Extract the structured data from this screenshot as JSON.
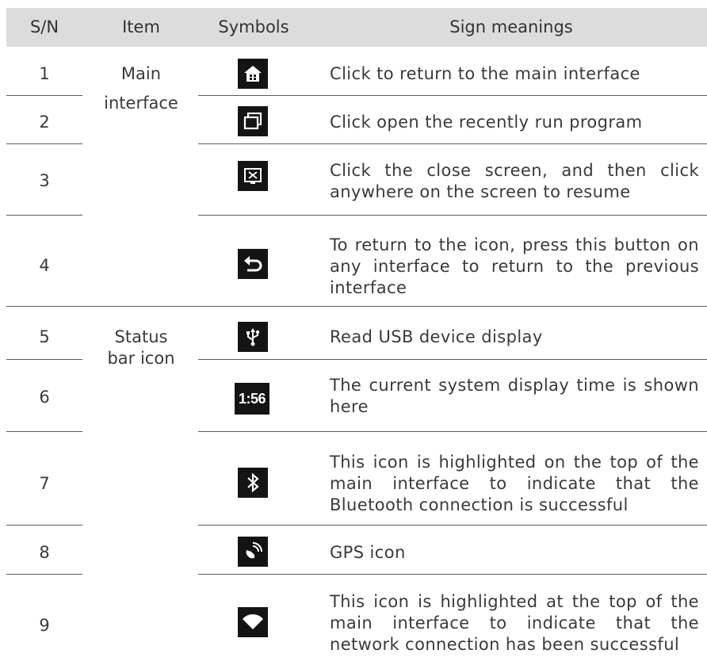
{
  "header": {
    "sn": "S/N",
    "item": "Item",
    "symbols": "Symbols",
    "meanings": "Sign meanings"
  },
  "groups": [
    {
      "label_line1": "Main",
      "label_line2": "interface"
    },
    {
      "label_line1": "Status",
      "label_line2": "bar icon"
    }
  ],
  "rows": [
    {
      "sn": "1",
      "icon": "home-icon",
      "meaning": "Click to return to the main interface"
    },
    {
      "sn": "2",
      "icon": "recent-apps-icon",
      "meaning": "Click open the recently run program"
    },
    {
      "sn": "3",
      "icon": "close-screen-icon",
      "meaning": "Click the close screen, and then click anywhere on the screen to resume"
    },
    {
      "sn": "4",
      "icon": "back-icon",
      "meaning": "To return to the icon, press this button on any interface to return to the previous interface"
    },
    {
      "sn": "5",
      "icon": "usb-icon",
      "meaning": "Read USB device display"
    },
    {
      "sn": "6",
      "icon": "clock-display",
      "clock_text": "1:56",
      "meaning": "The current system display time is shown here"
    },
    {
      "sn": "7",
      "icon": "bluetooth-icon",
      "meaning": "This icon is highlighted on the top of the main interface to indicate that the Bluetooth connection is successful"
    },
    {
      "sn": "8",
      "icon": "gps-icon",
      "meaning": "GPS icon"
    },
    {
      "sn": "9",
      "icon": "wifi-icon",
      "meaning": "This icon is highlighted at the top of the main interface to indicate that the network connection has been successful"
    }
  ],
  "colors": {
    "header_bg": "#dcdcdc",
    "icon_bg": "#141414",
    "text": "#3a3a3a",
    "rule": "#5a5a5a"
  }
}
